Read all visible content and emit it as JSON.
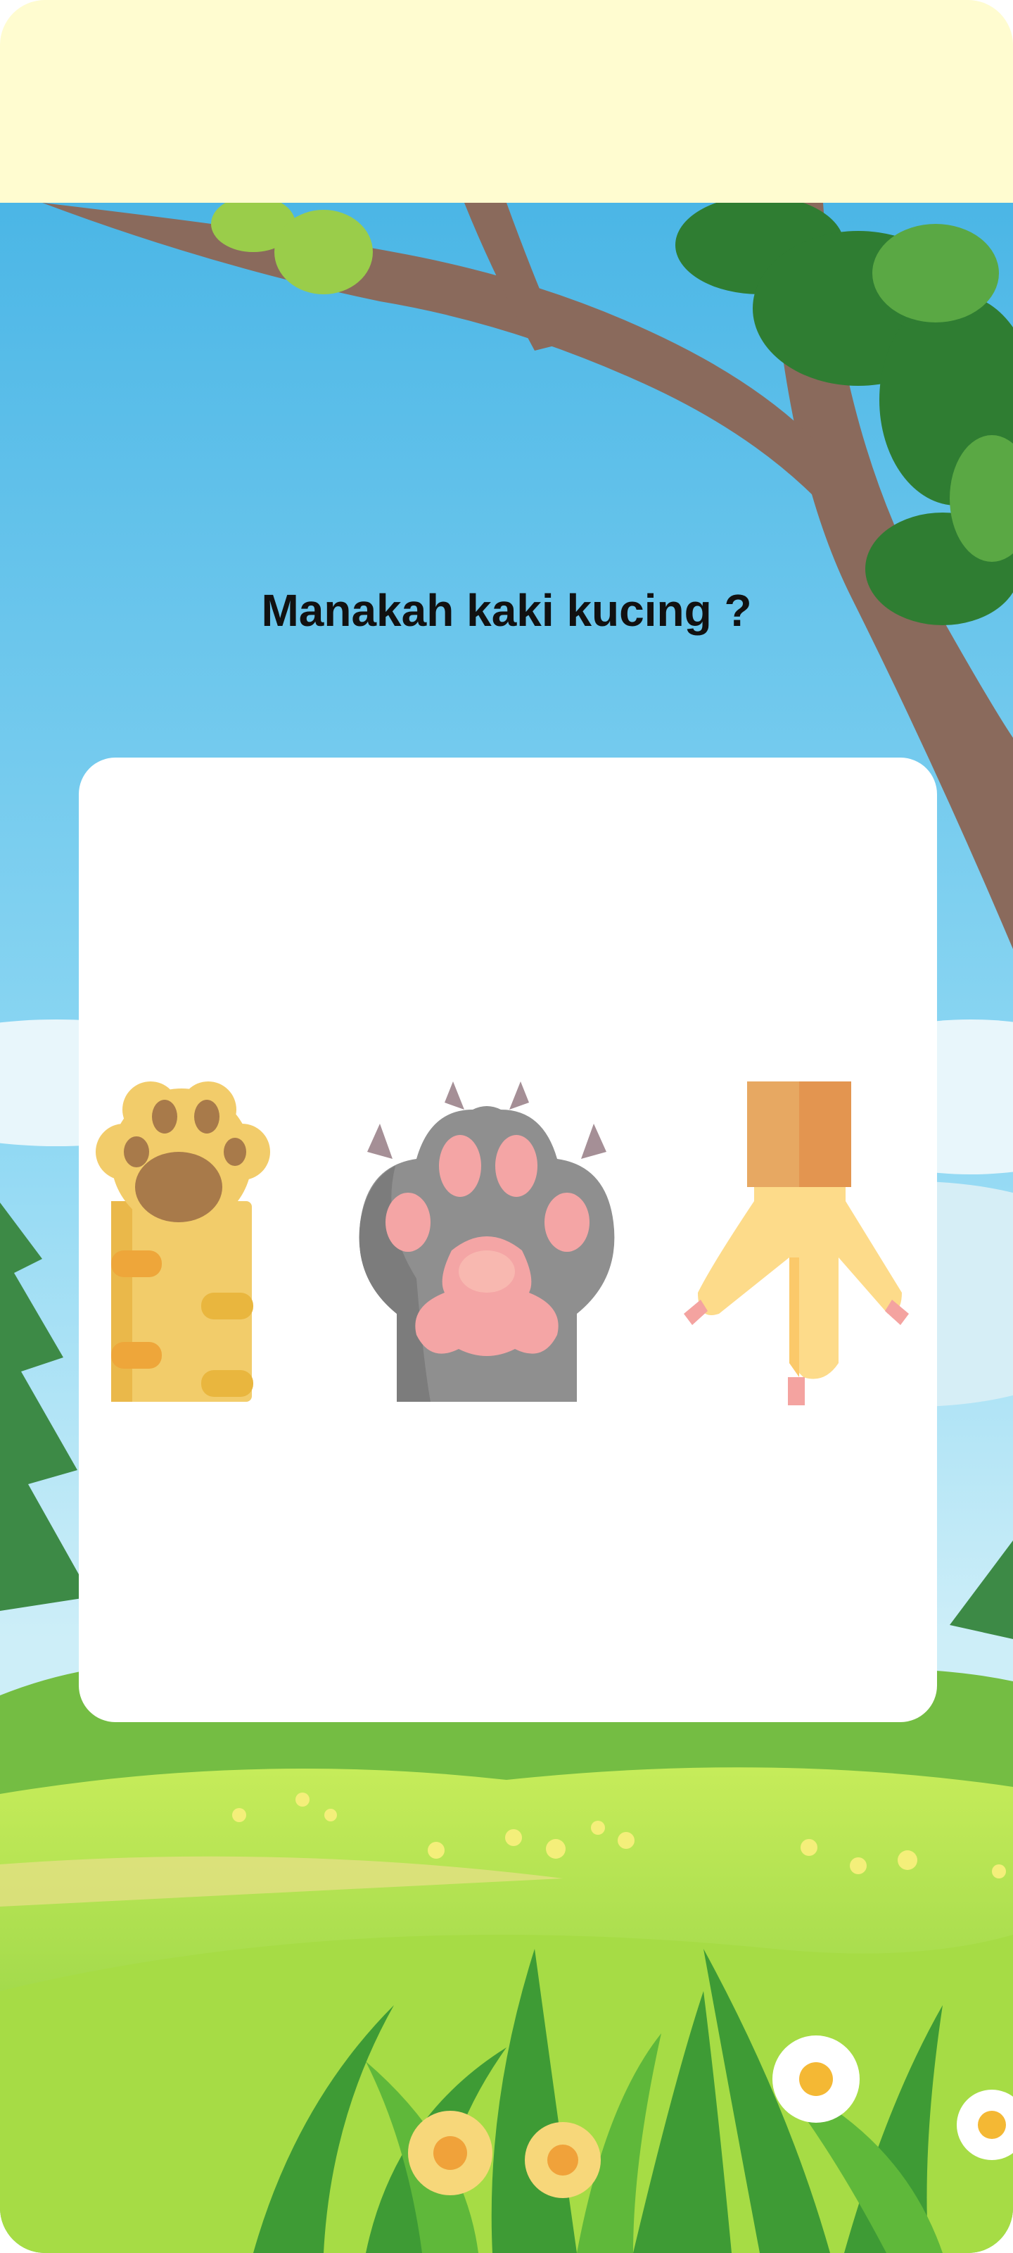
{
  "question": "Manakah kaki kucing ?",
  "options": [
    {
      "icon": "tabby-cat-paw-icon"
    },
    {
      "icon": "grey-cat-paw-icon"
    },
    {
      "icon": "chicken-foot-icon"
    }
  ],
  "colors": {
    "top_bar": "#fffcd0",
    "sky": "#7fcdee",
    "grass": "#8fd14a",
    "card": "#ffffff"
  }
}
